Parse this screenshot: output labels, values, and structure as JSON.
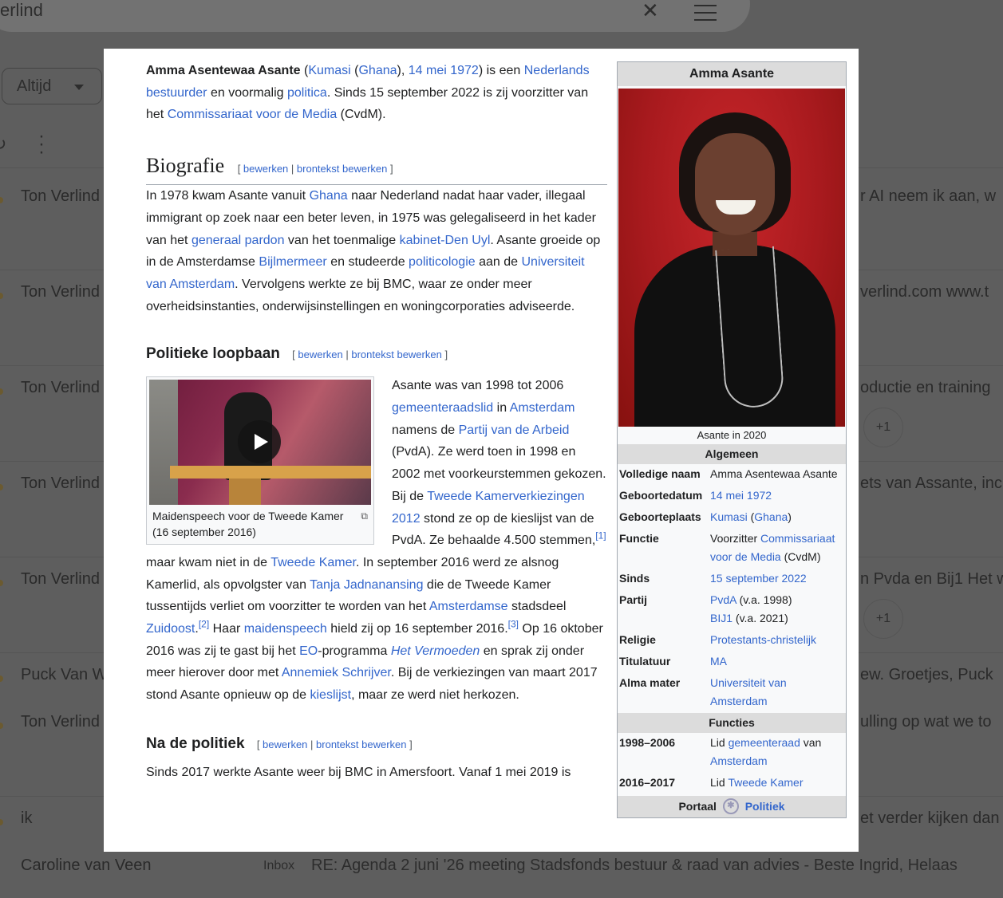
{
  "background": {
    "search_text": "erlind",
    "filter_chip": "Altijd",
    "rows": [
      {
        "sender": "Ton Verlind",
        "snippet": "r AI neem ik aan, w",
        "plus": ""
      },
      {
        "sender": "Ton Verlind",
        "snippet": "verlind.com www.t",
        "plus": ""
      },
      {
        "sender": "Ton Verlind",
        "snippet": "oductie en training",
        "plus": "+1"
      },
      {
        "sender": "Ton Verlind",
        "snippet": "ets van Assante, inc",
        "plus": ""
      },
      {
        "sender": "Ton Verlind",
        "snippet": "n Pvda en Bij1 Het w",
        "plus": "+1"
      },
      {
        "sender": "Puck Van W",
        "snippet": "ew. Groetjes, Puck",
        "plus": ""
      },
      {
        "sender": "Ton Verlind",
        "snippet": "ulling op wat we to",
        "plus": ""
      },
      {
        "sender": "ik",
        "snippet": "et verder kijken dan",
        "plus": ""
      },
      {
        "sender": "Caroline van Veen",
        "snippet": "",
        "plus": ""
      }
    ],
    "last_row_inbox": "Inbox",
    "last_row_subject": "RE: Agenda 2 juni '26 meeting Stadsfonds bestuur & raad van advies - Beste Ingrid, Helaas"
  },
  "article": {
    "lead": {
      "name": "Amma Asentewaa Asante",
      "t1": " (",
      "l_kumasi": "Kumasi",
      "t2": " (",
      "l_ghana": "Ghana",
      "t3": "), ",
      "l_date": "14 mei 1972",
      "t4": ") is een ",
      "l_bestuurder": "Nederlands bestuurder",
      "t5": " en voormalig ",
      "l_politica": "politica",
      "t6": ". Sinds 15 september 2022 is zij voorzitter van het ",
      "l_cvdm": "Commissariaat voor de Media",
      "t7": " (CvdM)."
    },
    "edit": {
      "open": "[ ",
      "edit": "bewerken",
      "sep": " | ",
      "source": "brontekst bewerken",
      "close": " ]"
    },
    "biografie": {
      "heading": "Biografie",
      "t1": "In 1978 kwam Asante vanuit ",
      "l_ghana": "Ghana",
      "t2": " naar Nederland nadat haar vader, illegaal immigrant op zoek naar een beter leven, in 1975 was gelegaliseerd in het kader van het ",
      "l_pardon": "generaal pardon",
      "t3": " van het toenmalige ",
      "l_kabinet": "kabinet-Den Uyl",
      "t4": ". Asante groeide op in de Amsterdamse ",
      "l_bijlmermeer": "Bijlmermeer",
      "t5": " en studeerde ",
      "l_politicologie": "politicologie",
      "t6": " aan de ",
      "l_uva": "Universiteit van Amsterdam",
      "t7": ". Vervolgens werkte ze bij BMC, waar ze onder meer overheidsinstanties, onderwijsinstellingen en woningcorporaties adviseerde."
    },
    "politiek": {
      "heading": "Politieke loopbaan",
      "video_caption": "Maidenspeech voor de Tweede Kamer (16 september 2016)",
      "t1": "Asante was van 1998 tot 2006 ",
      "l_gemeenteraadslid": "gemeenteraadslid",
      "t2": " in ",
      "l_amsterdam": "Amsterdam",
      "t3": " namens de ",
      "l_pvda": "Partij van de Arbeid",
      "t4": " (PvdA). Ze werd toen in 1998 en 2002 met voorkeurstemmen gekozen. Bij de ",
      "l_verkiezingen": "Tweede Kamerverkiezingen 2012",
      "t5": " stond ze op de kieslijst van de PvdA. Ze behaalde 4.500 stemmen,",
      "ref1": "[1]",
      "t6": " maar kwam niet in de ",
      "l_tk": "Tweede Kamer",
      "t7": ". In september 2016 werd ze alsnog Kamerlid, als opvolgster van ",
      "l_tanja": "Tanja Jadnanansing",
      "t8": " die de Tweede Kamer tussentijds verliet om voorzitter te worden van het ",
      "l_amsterdamse": "Amsterdamse",
      "t9": " stadsdeel ",
      "l_zuidoost": "Zuidoost",
      "t9b": ".",
      "ref2": "[2]",
      "t10": " Haar ",
      "l_maidenspeech": "maidenspeech",
      "t11": " hield zij op 16 september 2016.",
      "ref3": "[3]",
      "t12": " Op 16 oktober 2016 was zij te gast bij het ",
      "l_eo": "EO",
      "t13": "-programma ",
      "l_vermoeden": "Het Vermoeden",
      "t14": " en sprak zij onder meer hierover door met ",
      "l_annemiek": "Annemiek Schrijver",
      "t15": ". Bij de verkiezingen van maart 2017 stond Asante opnieuw op de ",
      "l_kieslijst": "kieslijst",
      "t16": ", maar ze werd niet herkozen."
    },
    "na": {
      "heading": "Na de politiek",
      "text": "Sinds 2017 werkte Asante weer bij BMC in Amersfoort. Vanaf 1 mei 2019 is"
    }
  },
  "infobox": {
    "title": "Amma Asante",
    "photo_caption": "Asante in 2020",
    "section_general": "Algemeen",
    "full_name_label": "Volledige naam",
    "full_name": "Amma Asentewaa Asante",
    "birthdate_label": "Geboortedatum",
    "birthdate": "14 mei 1972",
    "birthplace_label": "Geboorteplaats",
    "birthplace_city": "Kumasi",
    "birthplace_open": " (",
    "birthplace_country": "Ghana",
    "birthplace_close": ")",
    "function_label": "Functie",
    "function_prefix": "Voorzitter ",
    "function_link": "Commissariaat voor de Media",
    "function_suffix": " (CvdM)",
    "since_label": "Sinds",
    "since": "15 september 2022",
    "party_label": "Partij",
    "party1": "PvdA",
    "party1_note": " (v.a. 1998)",
    "party2": "BIJ1",
    "party2_note": " (v.a. 2021)",
    "religion_label": "Religie",
    "religion": "Protestants-christelijk",
    "title_label": "Titulatuur",
    "title_value": "MA",
    "alma_label": "Alma mater",
    "alma": "Universiteit van Amsterdam",
    "section_functions": "Functies",
    "f1_years": "1998–2006",
    "f1_prefix": "Lid ",
    "f1_link": "gemeenteraad",
    "f1_mid": " van ",
    "f1_place": "Amsterdam",
    "f2_years": "2016–2017",
    "f2_prefix": "Lid ",
    "f2_link": "Tweede Kamer",
    "portal_label": "Portaal",
    "portal_link": "Politiek"
  }
}
